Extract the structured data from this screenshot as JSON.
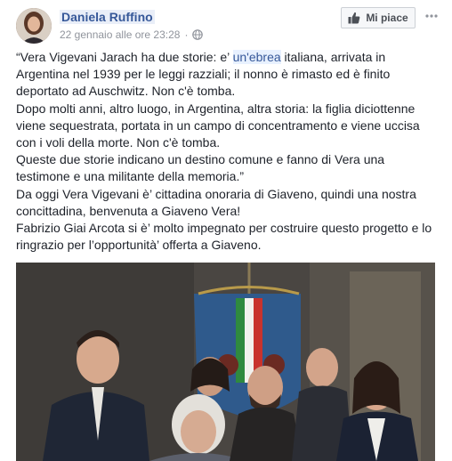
{
  "post": {
    "author": "Daniela Ruffino",
    "timestamp": "22 gennaio alle ore 23:28",
    "privacy_icon": "globe-icon",
    "like_label": "Mi piace",
    "text": {
      "l1_a": "“Vera Vigevani Jarach ha due storie: e’ ",
      "l1_hl": "un'ebrea",
      "l1_b": " italiana, arrivata in",
      "l2": "Argentina nel 1939 per le leggi razziali; il nonno è rimasto ed è finito",
      "l3": "deportato ad Auschwitz. Non c'è tomba.",
      "l4": "Dopo molti anni, altro luogo, in Argentina, altra storia: la figlia diciottenne",
      "l5": "viene sequestrata, portata in un campo di concentramento e viene uccisa",
      "l6": "con i voli della morte. Non c'è tomba.",
      "l7": "Queste due storie indicano un destino comune e fanno di Vera una",
      "l8": "testimone e una militante della memoria.”",
      "l9": "Da oggi Vera Vigevani è’ cittadina onoraria di Giaveno, quindi una nostra",
      "l10": "concittadina, benvenuta a Giaveno Vera!",
      "l11": "Fabrizio Giai Arcota si è’ molto impegnato per costruire questo progetto e lo",
      "l12": "ringrazio per l’opportunità’ offerta a Giaveno."
    }
  },
  "colors": {
    "link_blue": "#365899",
    "text": "#1d2129",
    "meta_gray": "#90949c",
    "button_bg": "#f6f7f9"
  }
}
